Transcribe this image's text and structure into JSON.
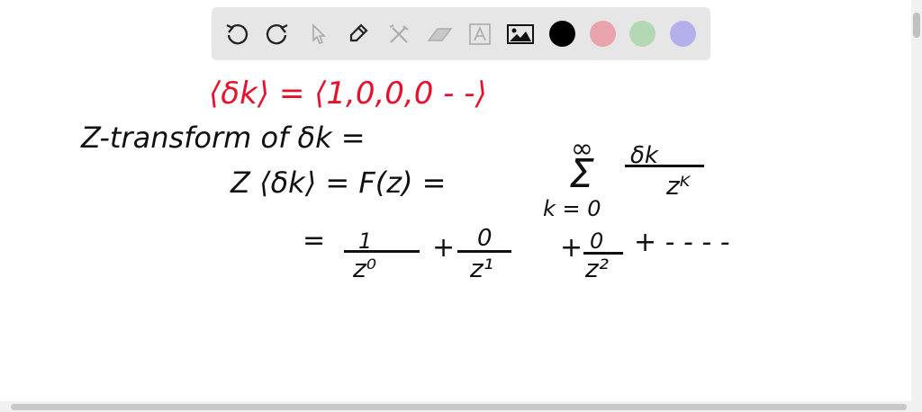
{
  "toolbar": {
    "tools": [
      "undo-icon",
      "redo-icon",
      "select-icon",
      "pen-icon",
      "tools-icon",
      "eraser-icon",
      "text-icon",
      "image-icon"
    ],
    "colors": [
      "#000000",
      "#e8a4aa",
      "#b4d8b4",
      "#b4b0ec"
    ]
  },
  "canvas": {
    "line1": "⟨δk⟩ = ⟨1,0,0,0 - -⟩",
    "line2": "Z-transform of  δk =",
    "line3_lhs": "Z ⟨δk⟩ = F(z) =",
    "sigma": "Σ",
    "sigma_top": "∞",
    "sigma_bottom": "k = 0",
    "frac_num": "δk",
    "frac_den": "zᴷ",
    "line4_eq": "=",
    "t1_num": "1",
    "t1_den": "z⁰",
    "plus1": "+",
    "t2_num": "0",
    "t2_den": "z¹",
    "plus2": "+",
    "t3_num": "0",
    "t3_den": "z²",
    "tail": "+ - - - -"
  }
}
